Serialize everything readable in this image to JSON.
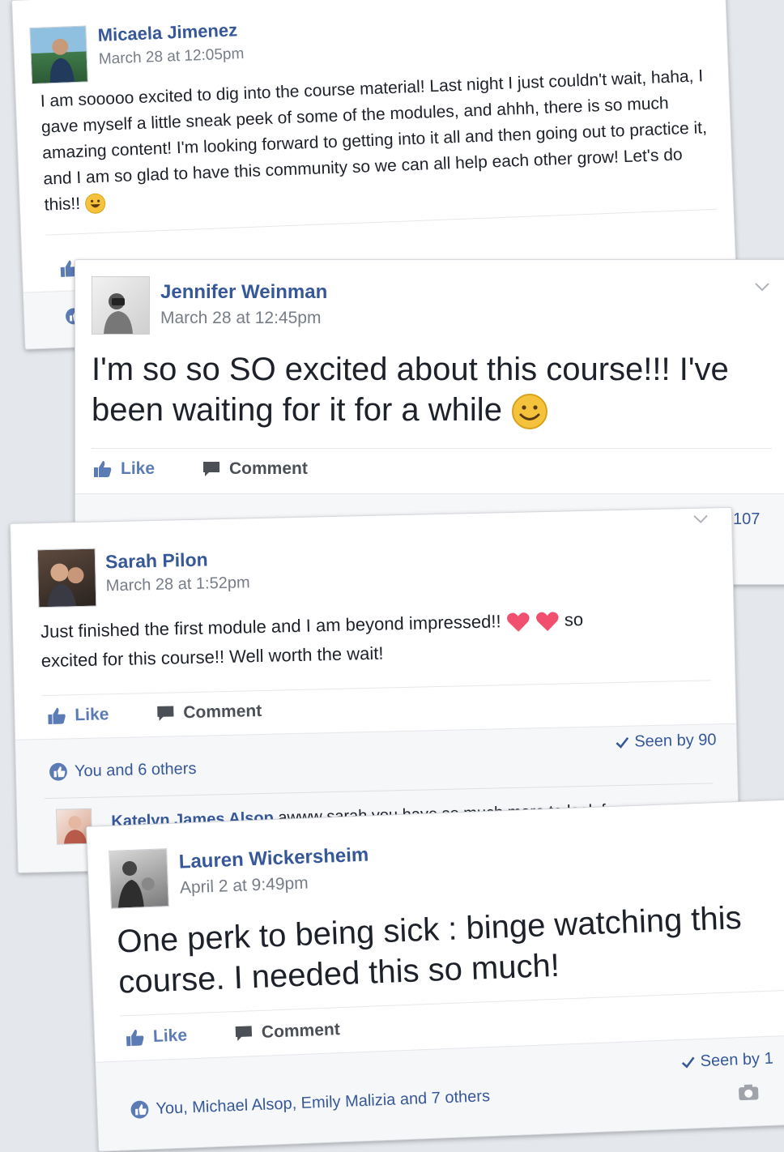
{
  "posts": [
    {
      "author": "Micaela Jimenez",
      "time": "March 28 at 12:05pm",
      "text": "I am sooooo excited to dig into the course material! Last night I just couldn't wait, haha, I gave myself a little sneak peek of some of the modules, and ahhh, there is so much amazing content! I'm looking forward to getting into it all and then going out to practice it, and I am so glad to have this community so we can all help each other grow! Let's do this!!"
    },
    {
      "author": "Jennifer Weinman",
      "time": "March 28 at 12:45pm",
      "text": "I'm so so SO excited about this course!!! I've been waiting for it for a while",
      "like_label": "Like",
      "comment_label": "Comment",
      "seen_partial": "107"
    },
    {
      "author": "Sarah Pilon",
      "time": "March 28 at 1:52pm",
      "text": "Just finished the first module and I am beyond impressed!!",
      "text_after_hearts": "so",
      "text_line2": "excited for this course!! Well worth the wait!",
      "like_label": "Like",
      "comment_label": "Comment",
      "reactions": "You and 6 others",
      "seen": "Seen by 90",
      "comment": {
        "author": "Katelyn James Alsop",
        "text": "awww sarah you have so much more to look f"
      }
    },
    {
      "author": "Lauren Wickersheim",
      "time": "April 2 at 9:49pm",
      "text_line1": "One perk to being sick : binge watching this",
      "text_line2": "course. I needed this so much!",
      "like_label": "Like",
      "comment_label": "Comment",
      "reactions": "You, Michael Alsop, Emily Malizia and 7 others",
      "seen": "Seen by 1"
    }
  ],
  "colors": {
    "link": "#365899",
    "like": "#5b7bb5",
    "heart": "#f0506e",
    "emoji": "#f5c33b"
  },
  "icons": [
    "thumbs-up-icon",
    "comment-bubble-icon",
    "checkmark-icon",
    "like-badge-icon",
    "heart-icon",
    "smiley-icon",
    "chevron-down-icon",
    "camera-icon"
  ]
}
